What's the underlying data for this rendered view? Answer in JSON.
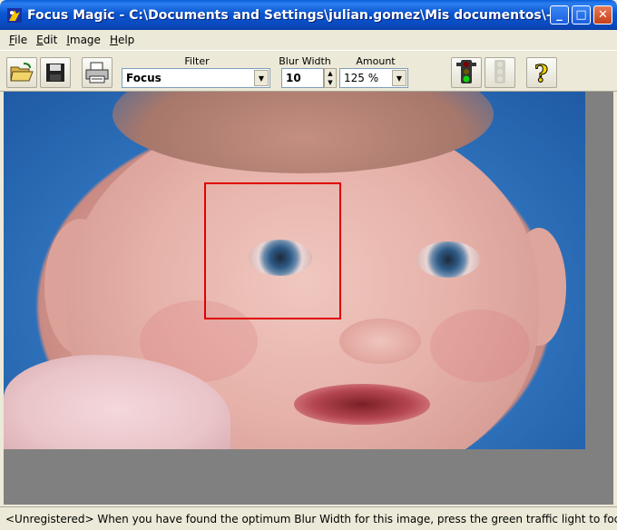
{
  "window": {
    "title": "Focus Magic - C:\\Documents and Settings\\julian.gomez\\Mis documentos\\- Mat...",
    "minimize_glyph": "_",
    "maximize_glyph": "□",
    "close_glyph": "✕"
  },
  "menu": {
    "items": [
      {
        "label": "File",
        "accel": "F"
      },
      {
        "label": "Edit",
        "accel": "E"
      },
      {
        "label": "Image",
        "accel": "I"
      },
      {
        "label": "Help",
        "accel": "H"
      }
    ]
  },
  "toolbar": {
    "filter_label": "Filter",
    "filter_value": "Focus",
    "blur_width_label": "Blur Width",
    "blur_width_value": "10",
    "amount_label": "Amount",
    "amount_value": "125 %",
    "icons": [
      "open-folder-icon",
      "save-disk-icon",
      "print-icon",
      "green-traffic-light-icon",
      "disabled-traffic-light-icon",
      "help-question-icon"
    ]
  },
  "status": {
    "text": "<Unregistered>  When you have found the optimum Blur Width for this image, press the green traffic light to focus th"
  },
  "colors": {
    "titlebar": "#0a5fd8",
    "selection_border": "#e00000",
    "workspace": "#808080"
  }
}
